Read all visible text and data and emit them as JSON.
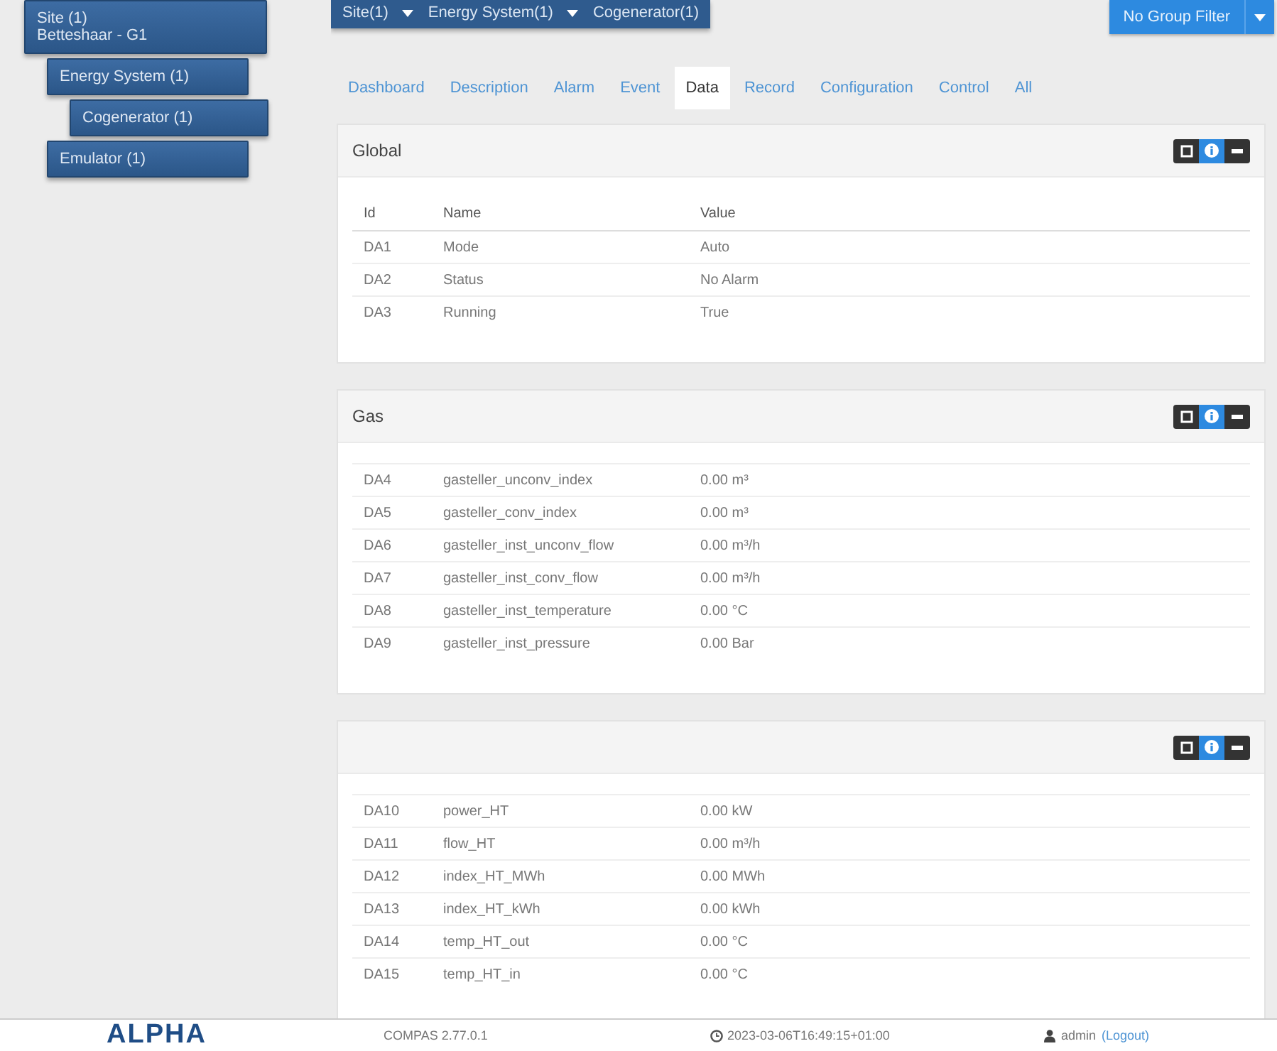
{
  "sidebar": {
    "items": [
      {
        "label": "Site (1)",
        "sublabel": "Betteshaar - G1",
        "children": [
          {
            "label": "Energy System (1)",
            "children": [
              {
                "label": "Cogenerator (1)"
              }
            ]
          },
          {
            "label": "Emulator (1)"
          }
        ]
      }
    ]
  },
  "breadcrumb": [
    "Site(1)",
    "Energy System(1)",
    "Cogenerator(1)"
  ],
  "group_filter": {
    "label": "No Group Filter"
  },
  "tabs": [
    {
      "label": "Dashboard",
      "selected": false
    },
    {
      "label": "Description",
      "selected": false
    },
    {
      "label": "Alarm",
      "selected": false
    },
    {
      "label": "Event",
      "selected": false
    },
    {
      "label": "Data",
      "selected": true
    },
    {
      "label": "Record",
      "selected": false
    },
    {
      "label": "Configuration",
      "selected": false
    },
    {
      "label": "Control",
      "selected": false
    },
    {
      "label": "All",
      "selected": false
    }
  ],
  "panels": [
    {
      "title": "Global",
      "columns": [
        "Id",
        "Name",
        "Value"
      ],
      "rows": [
        {
          "id": "DA1",
          "name": "Mode",
          "value": "Auto"
        },
        {
          "id": "DA2",
          "name": "Status",
          "value": "No Alarm"
        },
        {
          "id": "DA3",
          "name": "Running",
          "value": "True"
        }
      ]
    },
    {
      "title": "Gas",
      "rows": [
        {
          "id": "DA4",
          "name": "gasteller_unconv_index",
          "value": "0.00 m³"
        },
        {
          "id": "DA5",
          "name": "gasteller_conv_index",
          "value": "0.00 m³"
        },
        {
          "id": "DA6",
          "name": "gasteller_inst_unconv_flow",
          "value": "0.00 m³/h"
        },
        {
          "id": "DA7",
          "name": "gasteller_inst_conv_flow",
          "value": "0.00 m³/h"
        },
        {
          "id": "DA8",
          "name": "gasteller_inst_temperature",
          "value": "0.00 °C"
        },
        {
          "id": "DA9",
          "name": "gasteller_inst_pressure",
          "value": "0.00 Bar"
        }
      ]
    },
    {
      "rows": [
        {
          "id": "DA10",
          "name": "power_HT",
          "value": "0.00 kW"
        },
        {
          "id": "DA11",
          "name": "flow_HT",
          "value": "0.00 m³/h"
        },
        {
          "id": "DA12",
          "name": "index_HT_MWh",
          "value": "0.00 MWh"
        },
        {
          "id": "DA13",
          "name": "index_HT_kWh",
          "value": "0.00 kWh"
        },
        {
          "id": "DA14",
          "name": "temp_HT_out",
          "value": "0.00 °C"
        },
        {
          "id": "DA15",
          "name": "temp_HT_in",
          "value": "0.00 °C"
        }
      ]
    }
  ],
  "footer": {
    "logo": "ALPHA",
    "version": "COMPAS 2.77.0.1",
    "timestamp": "2023-03-06T16:49:15+01:00",
    "user": "admin",
    "logout": "(Logout)"
  }
}
